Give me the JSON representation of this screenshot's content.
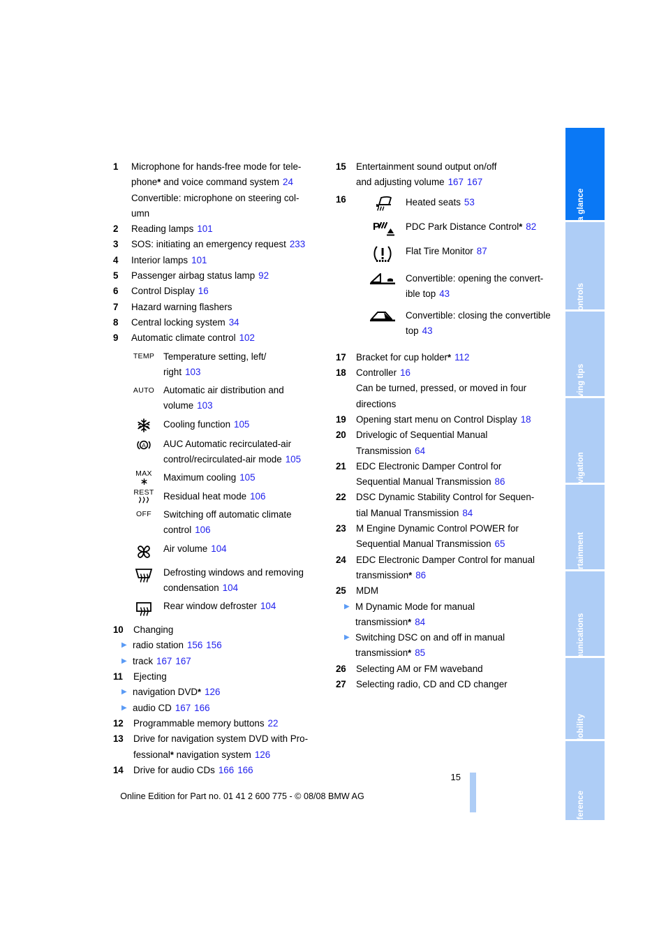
{
  "document": {
    "page_number": "15",
    "footer_note": "Online Edition for Part no. 01 41 2 600 775 - © 08/08 BMW AG",
    "link_color": "#2222ee",
    "active_tab_color": "#0a78f5",
    "inactive_tab_color": "#aecdf6"
  },
  "sidebar": {
    "tabs": [
      {
        "label": "At a glance",
        "active": true
      },
      {
        "label": "Controls",
        "active": false
      },
      {
        "label": "Driving tips",
        "active": false
      },
      {
        "label": "Navigation",
        "active": false
      },
      {
        "label": "Entertainment",
        "active": false
      },
      {
        "label": "Communications",
        "active": false
      },
      {
        "label": "Mobility",
        "active": false
      },
      {
        "label": "Reference",
        "active": false
      }
    ]
  },
  "left_column": {
    "item1": {
      "num": "1",
      "line1a": "Microphone for hands-free mode for tele-",
      "line2a": "phone",
      "line2b": " and voice command system",
      "line2ref": "24",
      "line3": "Convertible: microphone on steering col-",
      "line4": "umn"
    },
    "item2": {
      "num": "2",
      "text": "Reading lamps",
      "ref": "101"
    },
    "item3": {
      "num": "3",
      "text": "SOS: initiating an emergency request",
      "ref": "233"
    },
    "item4": {
      "num": "4",
      "text": "Interior lamps",
      "ref": "101"
    },
    "item5": {
      "num": "5",
      "text": "Passenger airbag status lamp",
      "ref": "92"
    },
    "item6": {
      "num": "6",
      "text": "Control Display",
      "ref": "16"
    },
    "item7": {
      "num": "7",
      "text": "Hazard warning flashers"
    },
    "item8": {
      "num": "8",
      "text": "Central locking system",
      "ref": "34"
    },
    "item9": {
      "num": "9",
      "text": "Automatic climate control",
      "ref": "102",
      "rows": [
        {
          "icon": "TEMP",
          "icon_kind": "text",
          "line1": "Temperature setting, left/",
          "line2": "right",
          "ref": "103"
        },
        {
          "icon": "AUTO",
          "icon_kind": "text",
          "line1": "Automatic air distribution and",
          "line2": "volume",
          "ref": "103"
        },
        {
          "icon": "snowflake-icon",
          "icon_kind": "glyph",
          "line1": "Cooling function",
          "ref": "105"
        },
        {
          "icon": "auc-recirculation-icon",
          "icon_kind": "glyph",
          "line1": "AUC Automatic recirculated-air",
          "line2": "control/recirculated-air mode",
          "ref": "105"
        },
        {
          "icon": "MAX",
          "icon_kind": "max",
          "line1": "Maximum cooling",
          "ref": "105"
        },
        {
          "icon": "REST",
          "icon_kind": "rest",
          "line1": "Residual heat mode",
          "ref": "106"
        },
        {
          "icon": "OFF",
          "icon_kind": "text",
          "line1": "Switching off automatic climate",
          "line2": "control",
          "ref": "106"
        },
        {
          "icon": "fan-icon",
          "icon_kind": "glyph",
          "line1": "Air volume",
          "ref": "104"
        },
        {
          "icon": "windshield-defroster-icon",
          "icon_kind": "glyph",
          "line1": "Defrosting windows and removing",
          "line2": "condensation",
          "ref": "104"
        },
        {
          "icon": "rear-window-defroster-icon",
          "icon_kind": "glyph",
          "line1": "Rear window defroster",
          "ref": "104"
        }
      ]
    },
    "item10": {
      "num": "10",
      "text": "Changing",
      "subs": [
        {
          "text": "radio station",
          "ref1": "156",
          "ref2": "156"
        },
        {
          "text": "track",
          "ref1": "167",
          "ref2": "167"
        }
      ]
    },
    "item11": {
      "num": "11",
      "text": "Ejecting",
      "subs": [
        {
          "text": "navigation DVD",
          "asterisk": true,
          "ref1": "126"
        },
        {
          "text": "audio CD",
          "ref1": "167",
          "ref2": "166"
        }
      ]
    },
    "item12": {
      "num": "12",
      "text": "Programmable memory buttons",
      "ref": "22"
    },
    "item13": {
      "num": "13",
      "line1": "Drive for navigation system DVD with Pro-",
      "line2a": "fessional",
      "line2b": " navigation system",
      "ref": "126"
    },
    "item14": {
      "num": "14",
      "text": "Drive for audio CDs",
      "ref1": "166",
      "ref2": "166"
    }
  },
  "right_column": {
    "item15": {
      "num": "15",
      "line1": "Entertainment sound output on/off",
      "line2": "and adjusting volume",
      "ref1": "167",
      "ref2": "167"
    },
    "item16": {
      "num": "16",
      "rows": [
        {
          "icon": "heated-seat-icon",
          "line1": "Heated seats",
          "ref": "53"
        },
        {
          "icon": "pdc-icon",
          "line1": "PDC Park Distance Control",
          "asterisk": true,
          "ref": "82"
        },
        {
          "icon": "flat-tire-monitor-icon",
          "line1": "Flat Tire Monitor",
          "ref": "87"
        },
        {
          "icon": "convertible-top-open-icon",
          "line1": "Convertible: opening the convert-",
          "line2": "ible top",
          "ref": "43"
        },
        {
          "icon": "convertible-top-close-icon",
          "line1": "Convertible: closing the convertible",
          "line2": "top",
          "ref": "43"
        }
      ]
    },
    "item17": {
      "num": "17",
      "text": "Bracket for cup holder",
      "asterisk": true,
      "ref": "112"
    },
    "item18": {
      "num": "18",
      "line1": "Controller",
      "ref": "16",
      "line2": "Can be turned, pressed, or moved in four",
      "line3": "directions"
    },
    "item19": {
      "num": "19",
      "text": "Opening start menu on Control Display",
      "ref": "18"
    },
    "item20": {
      "num": "20",
      "line1": "Drivelogic of Sequential Manual",
      "line2": "Transmission",
      "ref": "64"
    },
    "item21": {
      "num": "21",
      "line1": "EDC Electronic Damper Control for",
      "line2": "Sequential Manual Transmission",
      "ref": "86"
    },
    "item22": {
      "num": "22",
      "line1": "DSC Dynamic Stability Control for Sequen-",
      "line2": "tial Manual Transmission",
      "ref": "84"
    },
    "item23": {
      "num": "23",
      "line1": "M Engine Dynamic Control POWER for",
      "line2": "Sequential Manual Transmission",
      "ref": "65"
    },
    "item24": {
      "num": "24",
      "line1": "EDC Electronic Damper Control for manual",
      "line2": "transmission",
      "asterisk": true,
      "ref": "86"
    },
    "item25": {
      "num": "25",
      "text": "MDM",
      "subs": [
        {
          "line1": "M Dynamic Mode for manual",
          "line2": "transmission",
          "asterisk": true,
          "ref": "84"
        },
        {
          "line1": "Switching DSC on and off in manual",
          "line2": "transmission",
          "asterisk": true,
          "ref": "85"
        }
      ]
    },
    "item26": {
      "num": "26",
      "text": "Selecting AM or FM waveband"
    },
    "item27": {
      "num": "27",
      "text": "Selecting radio, CD and CD changer"
    }
  }
}
